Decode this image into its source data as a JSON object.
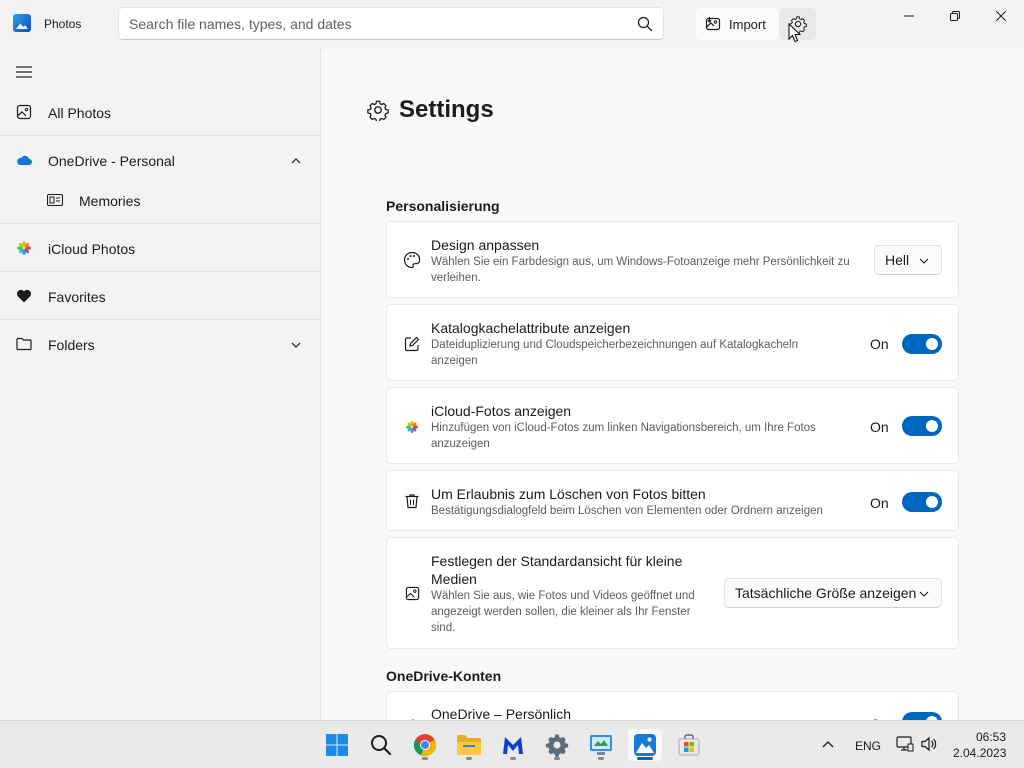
{
  "app": {
    "title": "Photos"
  },
  "search": {
    "placeholder": "Search file names, types, and dates"
  },
  "header": {
    "import_label": "Import"
  },
  "sidebar": {
    "items": [
      {
        "label": "All Photos"
      },
      {
        "label": "OneDrive - Personal"
      },
      {
        "label": "Memories"
      },
      {
        "label": "iCloud Photos"
      },
      {
        "label": "Favorites"
      },
      {
        "label": "Folders"
      }
    ]
  },
  "settings": {
    "title": "Settings",
    "sections": {
      "personalization": "Personalisierung",
      "onedrive": "OneDrive-Konten"
    },
    "cards": [
      {
        "title": "Design anpassen",
        "desc_line1": "Wählen Sie ein Farbdesign aus, um Windows-Fotoanzeige mehr Persönlichkeit zu",
        "desc_line2": "verleihen.",
        "value": "Hell"
      },
      {
        "title": "Katalogkachelattribute anzeigen",
        "desc_line1": "Dateiduplizierung und Cloudspeicherbezeichnungen auf Katalogkacheln",
        "desc_line2": "anzeigen",
        "state": "On"
      },
      {
        "title": "iCloud-Fotos anzeigen",
        "desc_line1": "Hinzufügen von iCloud-Fotos zum linken Navigationsbereich, um Ihre Fotos",
        "desc_line2": "anzuzeigen",
        "state": "On"
      },
      {
        "title": "Um Erlaubnis zum Löschen von Fotos bitten",
        "desc_line1": "Bestätigungsdialogfeld beim Löschen von Elementen oder Ordnern anzeigen",
        "state": "On"
      },
      {
        "title_line1": "Festlegen der Standardansicht für kleine",
        "title_line2": "Medien",
        "desc_line1": "Wählen Sie aus, wie Fotos und Videos geöffnet und",
        "desc_line2": "angezeigt werden sollen, die kleiner als Ihr Fenster",
        "desc_line3": "sind.",
        "value": "Tatsächliche Größe anzeigen"
      },
      {
        "title": "OneDrive – Persönlich",
        "state": "On"
      }
    ]
  },
  "taskbar": {
    "language": "ENG",
    "time": "06:53",
    "date": "2.04.2023"
  },
  "colors": {
    "accent": "#0067c0",
    "background": "#f3f3f3",
    "content_bg": "#f9f9f9",
    "card_bg": "#ffffff"
  }
}
